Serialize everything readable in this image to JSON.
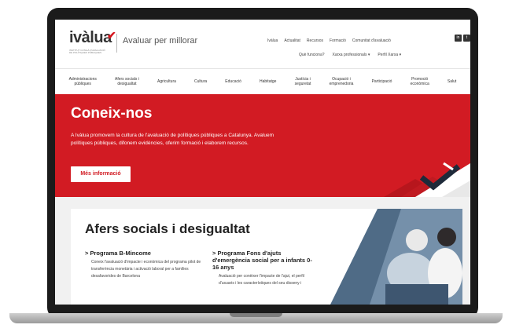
{
  "header": {
    "logo": "ivàlua",
    "logo_subtitle": "INSTITUT CATALÀ D'AVALUACIÓ DE POLÍTIQUES PÚBLIQUES",
    "tagline": "Avaluar per millorar",
    "top_links": [
      "Ivàlua",
      "Actualitat",
      "Recursos",
      "Formació",
      "Comunitat d'avaluació"
    ],
    "social_icons": [
      "linkedin-icon",
      "twitter-icon",
      "youtube-icon"
    ],
    "sub_links": [
      "Què funciona?",
      "Xarxa professionals ▾",
      "Perfil Xarxa ▾"
    ]
  },
  "nav": {
    "items": [
      "Administracions\npúbliques",
      "Afers socials i\ndesigualtat",
      "Agricultura",
      "Cultura",
      "Educació",
      "Habitatge",
      "Justícia i\nseguretat",
      "Ocupació i\nemprenedoria",
      "Participació",
      "Promoció\neconòmica",
      "Salut"
    ]
  },
  "hero": {
    "title": "Coneix-nos",
    "text": "A Ivàlua promovem la cultura de l'avaluació de polítiques públiques a Catalunya. Avaluem polítiques públiques, difonem evidències, oferim formació i elaborem recursos.",
    "button": "Més informació"
  },
  "section": {
    "title": "Afers socials i desigualtat",
    "col1_heading": "> Programa B-Mincome",
    "col1_text": "Coneix l'avaluació d'impacte i econòmica del programa pilot de transferència monetària i activació laboral per a famílies desafavorides de Barcelona",
    "col2_heading": "> Programa Fons d'ajuts d'emergència social per a infants 0-16 anys",
    "col2_text": "Avaluació per conèixer l'impacte de l'ajut, el perfil d'usuaris i les característiques del seu disseny i"
  },
  "colors": {
    "brand_red": "#d21b23",
    "laptop_frame": "#1b1b1b"
  }
}
